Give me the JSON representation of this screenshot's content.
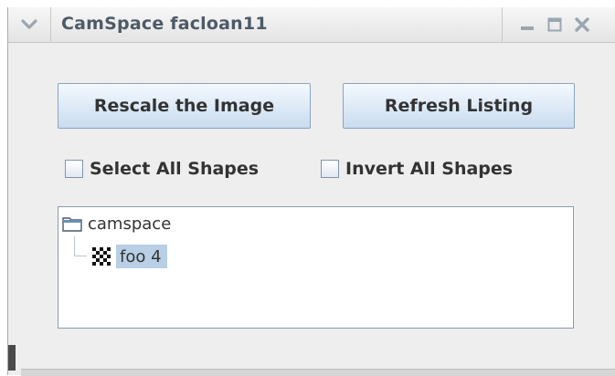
{
  "window": {
    "title": "CamSpace facloan11",
    "icons": [
      "chevron-down-icon",
      "minimize-icon",
      "maximize-icon",
      "close-icon"
    ]
  },
  "buttons": {
    "rescale": "Rescale the Image",
    "refresh": "Refresh Listing"
  },
  "checkboxes": {
    "select_all": {
      "label": "Select All Shapes",
      "checked": false
    },
    "invert_all": {
      "label": "Invert All Shapes",
      "checked": false
    }
  },
  "tree": {
    "root": {
      "label": "camspace",
      "icon": "folder-icon"
    },
    "children": [
      {
        "label": "foo 4",
        "icon": "checkerboard-icon",
        "selected": true
      }
    ]
  },
  "colors": {
    "title_text": "#4d5a68",
    "button_border": "#8aa4bf",
    "selection": "#b8cfe5"
  }
}
